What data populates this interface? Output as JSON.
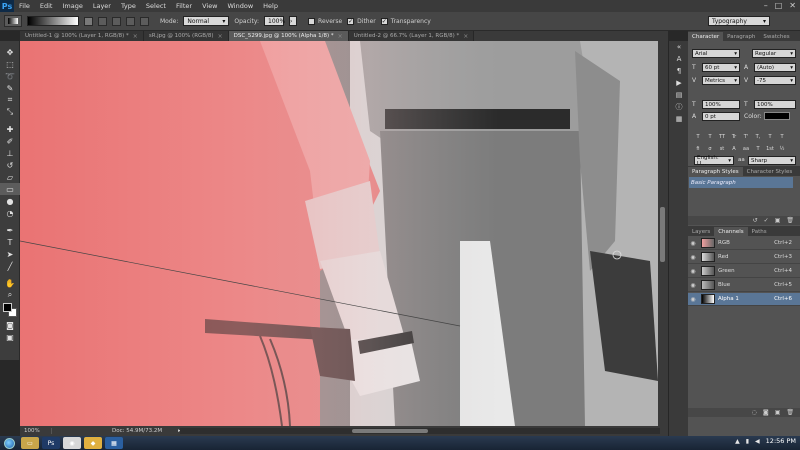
{
  "app": {
    "logo": "Ps"
  },
  "menu": [
    "File",
    "Edit",
    "Image",
    "Layer",
    "Type",
    "Select",
    "Filter",
    "View",
    "Window",
    "Help"
  ],
  "window_controls": {
    "minimize": "–",
    "maximize": "□",
    "close": "✕"
  },
  "options": {
    "mode_label": "Mode:",
    "mode_value": "Normal",
    "opacity_label": "Opacity:",
    "opacity_value": "100%",
    "reverse_label": "Reverse",
    "dither_label": "Dither",
    "transparency_label": "Transparency",
    "workspace": "Typography"
  },
  "tabs": [
    {
      "label": "Untitled-1 @ 100% (Layer 1, RGB/8) *",
      "active": false
    },
    {
      "label": "sR.jpg @ 100% (RGB/8)",
      "active": false
    },
    {
      "label": "DSC_5299.jpg @ 100% (Alpha 1/8) *",
      "active": true
    },
    {
      "label": "Untitled-2 @ 66.7% (Layer 1, RGB/8) *",
      "active": false
    }
  ],
  "status": {
    "zoom": "100%",
    "doc": "Doc: 54.9M/73.2M"
  },
  "character": {
    "tabs": [
      "Character",
      "Paragraph",
      "Swatches"
    ],
    "font_family": "Arial",
    "font_style": "Regular",
    "size": "60 pt",
    "leading": "(Auto)",
    "kerning": "Metrics",
    "tracking": "-75",
    "vscale": "100%",
    "hscale": "100%",
    "baseline": "0 pt",
    "color_label": "Color:",
    "format_buttons": [
      "T",
      "T",
      "TT",
      "Tr",
      "T'",
      "T,",
      "T",
      "T"
    ],
    "extra_buttons": [
      "fi",
      "σ",
      "st",
      "A",
      "aa",
      "T",
      "1st",
      "½"
    ],
    "language": "English: U...",
    "antialias_icon": "aa",
    "antialias": "Sharp"
  },
  "paragraph_styles": {
    "tabs": [
      "Paragraph Styles",
      "Character Styles"
    ],
    "item": "Basic Paragraph"
  },
  "channels": {
    "tabs": [
      "Layers",
      "Channels",
      "Paths"
    ],
    "rows": [
      {
        "name": "RGB",
        "key": "Ctrl+2",
        "selected": false,
        "eye": "◉"
      },
      {
        "name": "Red",
        "key": "Ctrl+3",
        "selected": false,
        "eye": "◉"
      },
      {
        "name": "Green",
        "key": "Ctrl+4",
        "selected": false,
        "eye": "◉"
      },
      {
        "name": "Blue",
        "key": "Ctrl+5",
        "selected": false,
        "eye": "◉"
      },
      {
        "name": "Alpha 1",
        "key": "Ctrl+6",
        "selected": true,
        "eye": "◉"
      }
    ]
  },
  "taskbar": {
    "time": "12:56 PM"
  },
  "colors": {
    "accent": "#5a7696",
    "mask_overlay": "#f07070"
  }
}
